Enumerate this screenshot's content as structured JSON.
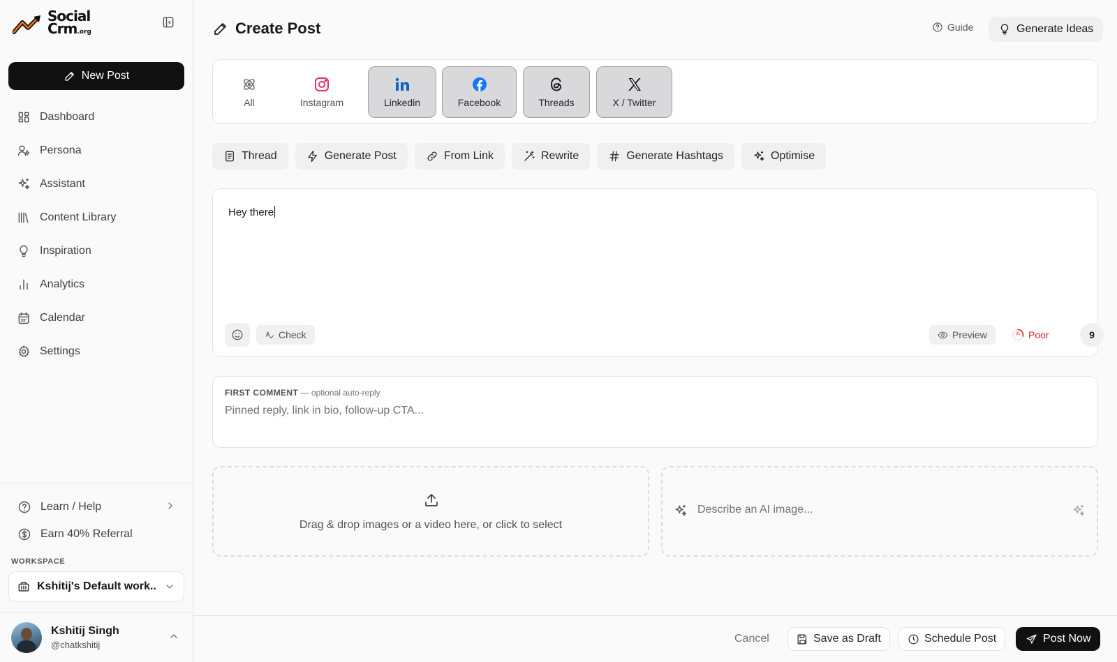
{
  "sidebar": {
    "logo": {
      "line1": "Social",
      "line2": "Crm",
      "suffix": ".org"
    },
    "new_post_label": "New Post",
    "nav": [
      {
        "label": "Dashboard",
        "icon": "dashboard-icon"
      },
      {
        "label": "Persona",
        "icon": "persona-icon"
      },
      {
        "label": "Assistant",
        "icon": "sparkles-icon"
      },
      {
        "label": "Content Library",
        "icon": "library-icon"
      },
      {
        "label": "Inspiration",
        "icon": "lightbulb-icon"
      },
      {
        "label": "Analytics",
        "icon": "bar-chart-icon"
      },
      {
        "label": "Calendar",
        "icon": "calendar-icon"
      },
      {
        "label": "Settings",
        "icon": "gear-icon"
      }
    ],
    "learn_help_label": "Learn / Help",
    "referral_label": "Earn 40% Referral",
    "workspace_label": "WORKSPACE",
    "workspace_name": "Kshitij's Default work...",
    "user": {
      "name": "Kshitij Singh",
      "handle": "@chatkshitij"
    }
  },
  "header": {
    "title": "Create Post",
    "guide_label": "Guide",
    "generate_ideas_label": "Generate Ideas"
  },
  "platforms": [
    {
      "label": "All",
      "selected": false
    },
    {
      "label": "Instagram",
      "selected": false
    },
    {
      "label": "Linkedin",
      "selected": true
    },
    {
      "label": "Facebook",
      "selected": true
    },
    {
      "label": "Threads",
      "selected": true
    },
    {
      "label": "X / Twitter",
      "selected": true
    }
  ],
  "tools": [
    "Thread",
    "Generate Post",
    "From Link",
    "Rewrite",
    "Generate Hashtags",
    "Optimise"
  ],
  "editor": {
    "content": "Hey there",
    "check_label": "Check",
    "preview_label": "Preview",
    "score_value": "31",
    "score_label": "Poor",
    "char_count": "9"
  },
  "first_comment": {
    "label": "FIRST COMMENT",
    "sublabel": " — optional auto-reply",
    "placeholder": "Pinned reply, link in bio, follow-up CTA..."
  },
  "media": {
    "drop_text": "Drag & drop images or a video here, or click to select",
    "ai_placeholder": "Describe an AI image..."
  },
  "footer": {
    "cancel_label": "Cancel",
    "save_draft_label": "Save as Draft",
    "schedule_label": "Schedule Post",
    "post_now_label": "Post Now"
  },
  "colors": {
    "primary": "#111111",
    "instagram": "#e1306c",
    "linkedin": "#0a66c2",
    "facebook": "#1877f2",
    "score_poor": "#dc2626"
  }
}
